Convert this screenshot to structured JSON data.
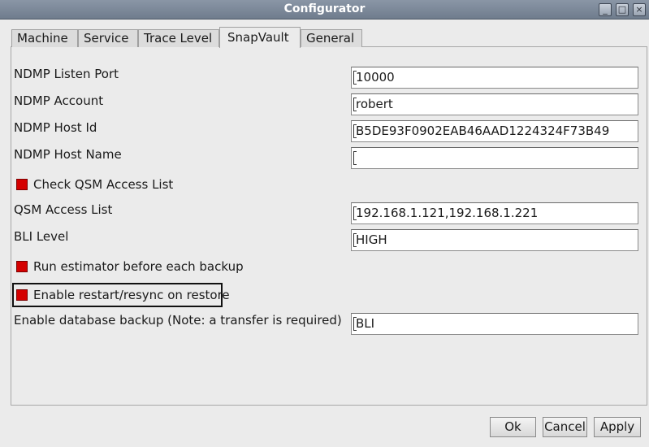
{
  "window": {
    "title": "Configurator"
  },
  "tabs": [
    {
      "label": "Machine"
    },
    {
      "label": "Service"
    },
    {
      "label": "Trace Level"
    },
    {
      "label": "SnapVault"
    },
    {
      "label": "General"
    }
  ],
  "active_tab": "SnapVault",
  "form": {
    "ndmp_listen_port": {
      "label": "NDMP Listen Port",
      "value": "10000"
    },
    "ndmp_account": {
      "label": "NDMP Account",
      "value": "robert"
    },
    "ndmp_host_id": {
      "label": "NDMP Host Id",
      "value": "B5DE93F0902EAB46AAD1224324F73B49"
    },
    "ndmp_host_name": {
      "label": "NDMP Host Name",
      "value": ""
    },
    "check_qsm": {
      "label": "Check QSM Access List",
      "checked": true
    },
    "qsm_access_list": {
      "label": "QSM Access List",
      "value": "192.168.1.121,192.168.1.221"
    },
    "bli_level": {
      "label": "BLI Level",
      "value": "HIGH"
    },
    "run_estimator": {
      "label": "Run estimator before each backup",
      "checked": true
    },
    "enable_restart": {
      "label": "Enable restart/resync on restore",
      "checked": true
    },
    "enable_db_backup": {
      "label": "Enable database backup (Note: a transfer is required)",
      "value": "BLI"
    }
  },
  "buttons": {
    "ok": "Ok",
    "cancel": "Cancel",
    "apply": "Apply"
  },
  "colors": {
    "checkbox_checked": "#d40000",
    "titlebar": "#7d8999"
  }
}
